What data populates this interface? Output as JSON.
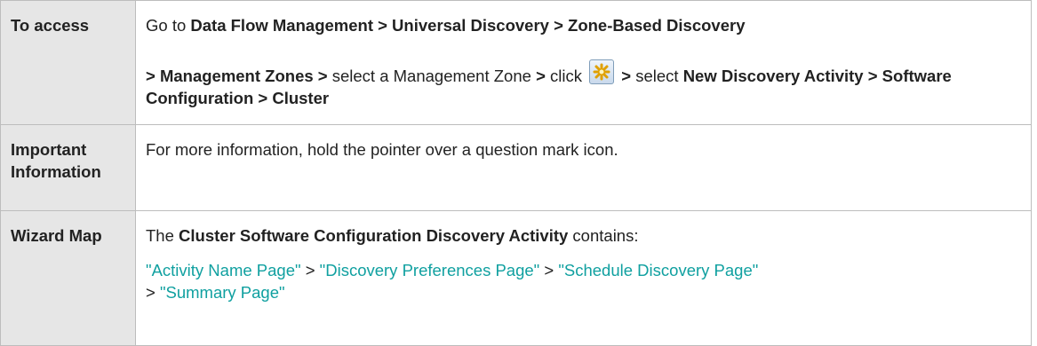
{
  "rows": {
    "access": {
      "label": "To access",
      "t1": "Go to ",
      "b1": "Data Flow Management > Universal Discovery > Zone-Based Discovery",
      "b2": "> Management Zones >",
      "t2": " select a Management Zone ",
      "b3": ">",
      "t3": " click ",
      "icon": "new-asterisk-icon",
      "b4": ">",
      "t4": " select ",
      "b5": "New Discovery Activity > Software Configuration > Cluster"
    },
    "important": {
      "label": "Important Information",
      "text": "For more information, hold the pointer over a question mark icon."
    },
    "wizard": {
      "label": "Wizard Map",
      "t1": "The ",
      "b1": "Cluster Software Configuration Discovery Activity",
      "t2": " contains:",
      "links": [
        "\"Activity Name Page\"",
        "\"Discovery Preferences Page\"",
        "\"Schedule Discovery Page\"",
        "\"Summary Page\""
      ],
      "sep": " > "
    }
  },
  "colors": {
    "link": "#10a0a0",
    "label_bg": "#e6e6e6",
    "border": "#bdbdbd"
  }
}
